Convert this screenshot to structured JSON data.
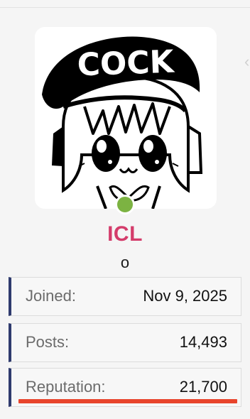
{
  "profile": {
    "avatar_caption": "COCK",
    "username": "ICL",
    "user_title": "o",
    "online_status_color": "#7cb342",
    "username_color": "#d43c6b"
  },
  "stats": [
    {
      "label": "Joined:",
      "value": "Nov 9, 2025"
    },
    {
      "label": "Posts:",
      "value": "14,493"
    },
    {
      "label": "Reputation:",
      "value": "21,700"
    }
  ],
  "colors": {
    "row_accent": "#2f3b6e",
    "highlight_mark": "#e8442c"
  },
  "icons": {
    "side_chevron": "chevron-left-icon"
  }
}
